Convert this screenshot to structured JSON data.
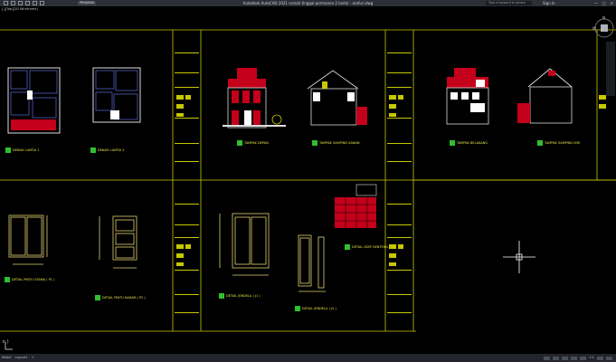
{
  "window": {
    "title": "Autodesk AutoCAD 2021   rumah tinggal permanen 2 lantai - arafuri.dwg",
    "project": "PROJEKSI",
    "search_placeholder": "Type a keyword or phrase",
    "signin": "Sign In",
    "min": "—",
    "max": "□",
    "close": "✕"
  },
  "view_label": "[-][Top][2D Wireframe]",
  "viewcube": {
    "north": "N",
    "south": "S",
    "west": "W",
    "east": "E"
  },
  "command_prompt": "×  ⟩",
  "statusbar": {
    "tabs": [
      "Model",
      "Layout1",
      "+"
    ],
    "scale": "1:1"
  },
  "labels": {
    "plan1": "DENAH LANTAI 1",
    "plan2": "DENAH LANTAI 2",
    "elev1": "TAMPAK DEPAN",
    "elev2": "TAMPAK SAMPING KANAN",
    "elev3": "TAMPAK BELAKANG",
    "elev4": "TAMPAK SAMPING KIRI",
    "door1": "DETAIL PINTU UTAMA ( P1 )",
    "door2": "DETAIL PINTU KAMAR ( P2 )",
    "door3": "DETAIL JENDELA ( J1 )",
    "window1": "DETAIL JENDELA ( J2 )",
    "roof": "DETAIL ATAP GENTENG",
    "scale_note": "SKALA 1:100"
  }
}
